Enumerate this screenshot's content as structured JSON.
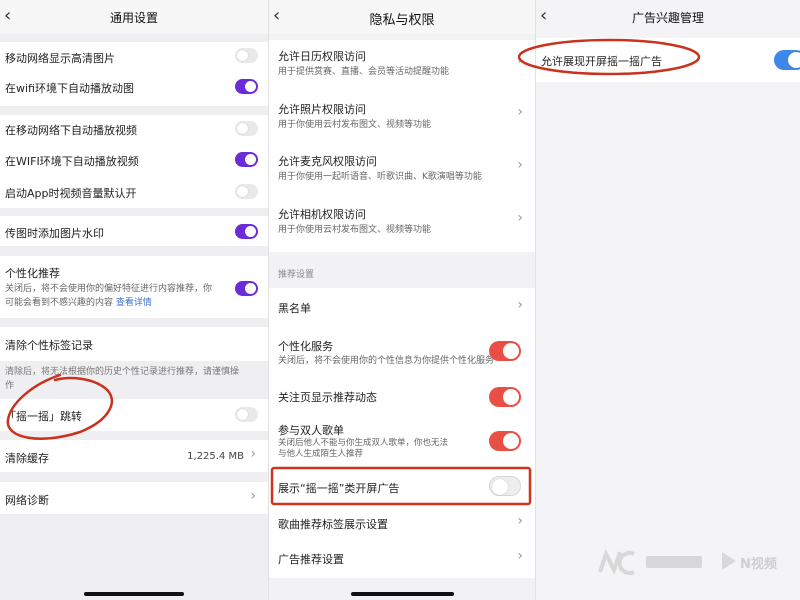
{
  "panel1": {
    "title": "通用设置",
    "items": [
      {
        "label": "移动网络显示高清图片",
        "toggle": "off"
      },
      {
        "label": "在wifi环境下自动播放动图",
        "toggle": "on"
      },
      {
        "label": "在移动网络下自动播放视频",
        "toggle": "off"
      },
      {
        "label": "在WIFI环境下自动播放视频",
        "toggle": "on"
      },
      {
        "label": "启动App时视频音量默认开",
        "toggle": "off"
      },
      {
        "label": "传图时添加图片水印",
        "toggle": "on"
      }
    ],
    "personalized": {
      "label": "个性化推荐",
      "desc_line1": "关闭后，将不会使用你的偏好特征进行内容推荐，你",
      "desc_line2": "可能会看到不感兴趣的内容",
      "link": "查看详情",
      "toggle": "on"
    },
    "clear_tags": {
      "label": "清除个性标签记录",
      "desc_line1": "清除后，将无法根据你的历史个性记录进行推荐，请谨慎操",
      "desc_line2": "作"
    },
    "shake": {
      "label": "「摇一摇」跳转",
      "toggle": "off"
    },
    "cache": {
      "label": "清除缓存",
      "value": "1,225.4 MB"
    },
    "network": {
      "label": "网络诊断"
    }
  },
  "panel2": {
    "title": "隐私与权限",
    "permissions": [
      {
        "label": "允许日历权限访问",
        "desc": "用于提供赏赛、直播、会员等活动提醒功能"
      },
      {
        "label": "允许照片权限访问",
        "desc": "用于你使用云村发布图文、视频等功能"
      },
      {
        "label": "允许麦克风权限访问",
        "desc": "用于你使用一起听语音、听歌识曲、K歌演唱等功能"
      },
      {
        "label": "允许相机权限访问",
        "desc": "用于你使用云村发布图文、视频等功能"
      }
    ],
    "section_label": "推荐设置",
    "blacklist": {
      "label": "黑名单"
    },
    "personal_service": {
      "label": "个性化服务",
      "desc": "关闭后，将不会使用你的个性信息为你提供个性化服务",
      "toggle": "on"
    },
    "follow_feed": {
      "label": "关注页显示推荐动态",
      "toggle": "on"
    },
    "duo_playlist": {
      "label": "参与双人歌单",
      "desc_line1": "关闭后他人不能与你生成双人歌单，你也无法",
      "desc_line2": "与他人生成陌生人推荐",
      "toggle": "on"
    },
    "shake_ad": {
      "label": "展示“摇一摇”类开屏广告",
      "toggle": "off"
    },
    "song_tags": {
      "label": "歌曲推荐标签展示设置"
    },
    "ad_settings": {
      "label": "广告推荐设置"
    }
  },
  "panel3": {
    "title": "广告兴趣管理",
    "item": {
      "label": "允许展现开屏摇一摇广告",
      "toggle": "on"
    }
  },
  "watermark": {
    "brand_text": "N视频"
  },
  "colors": {
    "purple_toggle": "#6c2bd9",
    "red_toggle": "#ea4f46",
    "blue_toggle": "#3e86e8",
    "annotation_red": "#c8321e"
  }
}
